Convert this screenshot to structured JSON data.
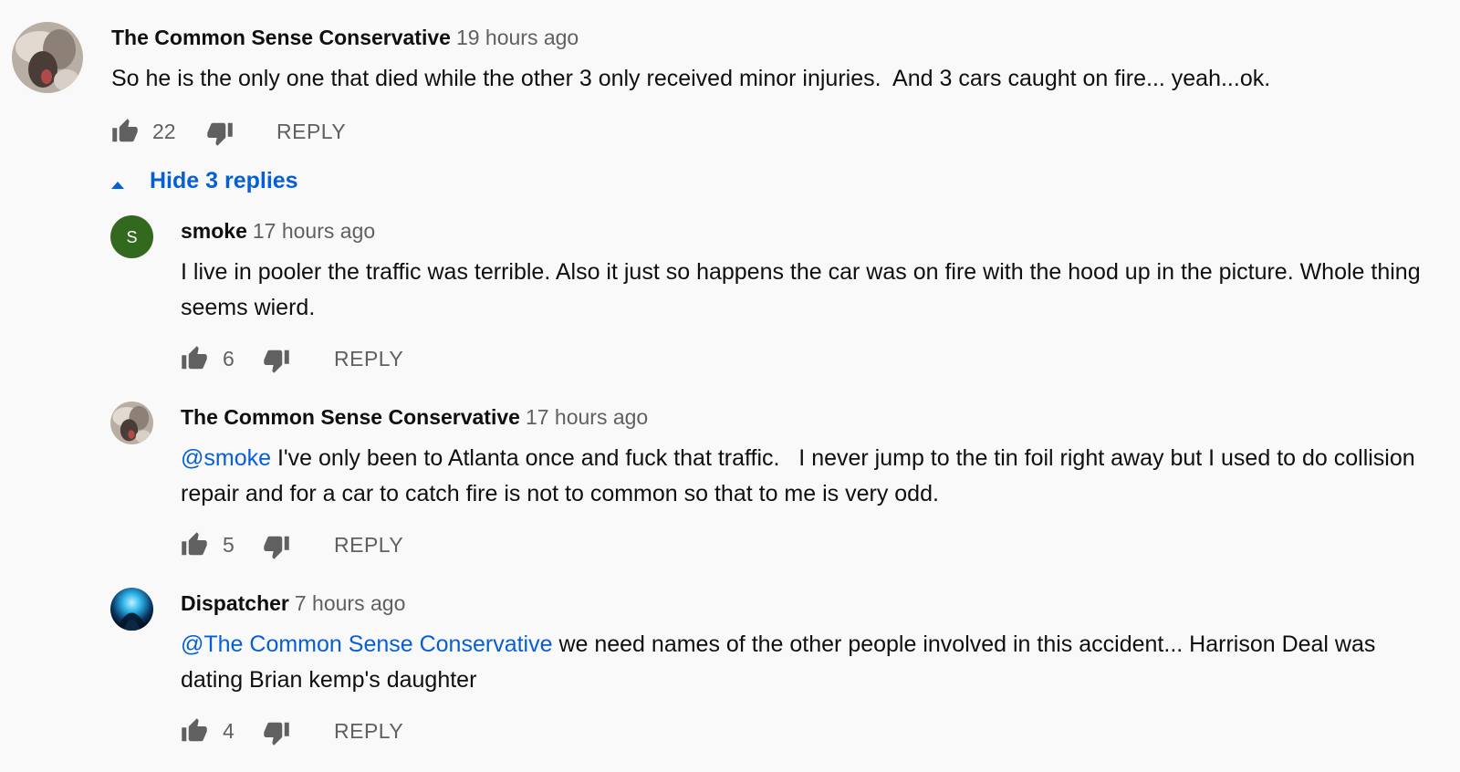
{
  "comment": {
    "author": "The Common Sense Conservative",
    "time": "19 hours ago",
    "text": "So he is the only one that died while the other 3 only received minor injuries.  And 3 cars caught on fire... yeah...ok.",
    "likes": "22",
    "reply_label": "REPLY",
    "avatar_icon": "profile-photo-icon"
  },
  "replies_toggle": {
    "label": "Hide 3 replies",
    "icon": "caret-up-icon"
  },
  "replies": [
    {
      "author": "smoke",
      "time": "17 hours ago",
      "avatar_letter": "S",
      "avatar_color": "#33691e",
      "mention": "",
      "text": "I live in pooler the traffic was terrible. Also it just so happens the car was on fire with the hood up in the picture. Whole thing seems wierd.",
      "likes": "6",
      "reply_label": "REPLY"
    },
    {
      "author": "The Common Sense Conservative",
      "time": "17 hours ago",
      "avatar_letter": "",
      "mention": "@smoke",
      "text": " I've only been to Atlanta once and fuck that traffic.   I never jump to the tin foil right away but I used to do collision repair and for a car to catch fire is not to common so that to me is very odd.",
      "likes": "5",
      "reply_label": "REPLY"
    },
    {
      "author": "Dispatcher",
      "time": "7 hours ago",
      "avatar_letter": "",
      "mention": "@The Common Sense Conservative",
      "text": " we need names of the other people involved in this accident... Harrison Deal was dating Brian kemp's daughter",
      "likes": "4",
      "reply_label": "REPLY"
    }
  ],
  "colors": {
    "link": "#065fd4",
    "secondary_text": "#606060",
    "background": "#f9f9f9"
  }
}
